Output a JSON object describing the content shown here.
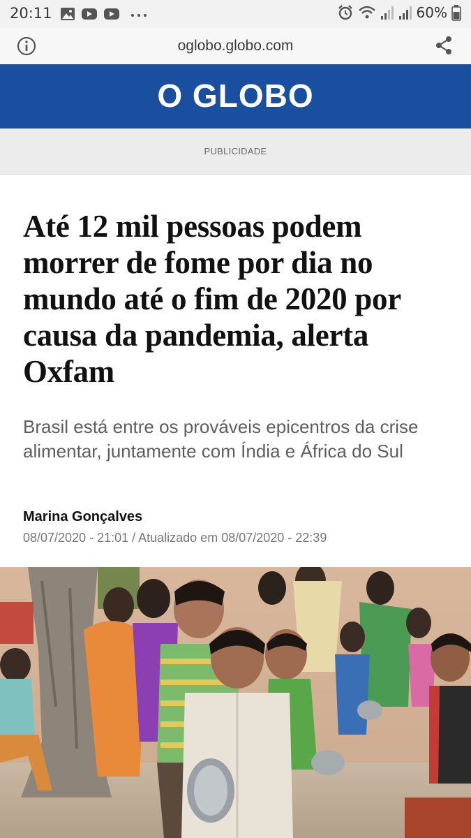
{
  "status_bar": {
    "time": "20:11",
    "battery": "60%",
    "left_icons": [
      "gallery-icon",
      "youtube-icon",
      "youtube-icon",
      "more-dots-icon"
    ],
    "right_icons": [
      "alarm-icon",
      "wifi-icon",
      "signal-icon",
      "signal-icon",
      "battery-icon"
    ]
  },
  "browser": {
    "url": "oglobo.globo.com",
    "info_icon": "info-icon",
    "share_icon": "share-icon"
  },
  "header": {
    "logo": "O GLOBO",
    "brand_color": "#1a4fa0"
  },
  "ad": {
    "label": "PUBLICIDADE"
  },
  "article": {
    "headline": "Até 12 mil pessoas podem morrer de fome por dia no mundo até o fim de 2020 por causa da pandemia, alerta Oxfam",
    "subtitle": "Brasil está entre os prováveis epicentros da crise alimentar, juntamente com Índia e África do Sul",
    "author": "Marina Gonçalves",
    "dateline": "08/07/2020 - 21:01 / Atualizado em 08/07/2020 - 22:39"
  }
}
